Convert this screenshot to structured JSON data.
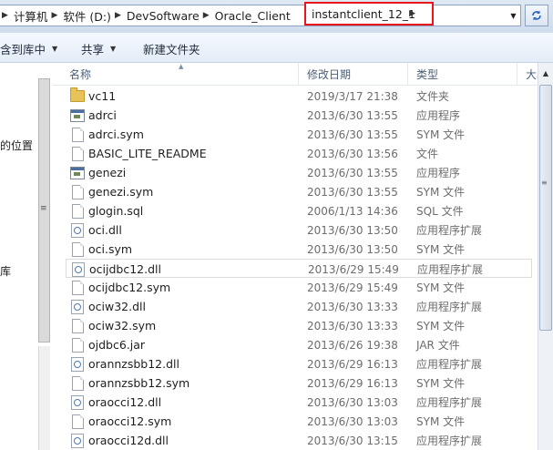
{
  "address": {
    "segments": [
      "计算机",
      "软件 (D:)",
      "DevSoftware",
      "Oracle_Client"
    ],
    "current": "instantclient_12_1"
  },
  "toolbar": {
    "include_in_library": "含到库中",
    "share": "共享",
    "new_folder": "新建文件夹"
  },
  "nav": {
    "items": [
      "的位置",
      "库"
    ]
  },
  "columns": {
    "name": "名称",
    "date": "修改日期",
    "type": "类型",
    "size": "大小"
  },
  "files": [
    {
      "name": "vc11",
      "date": "2019/3/17 21:38",
      "type": "文件夹",
      "icon": "folder-icon"
    },
    {
      "name": "adrci",
      "date": "2013/6/30 13:55",
      "type": "应用程序",
      "icon": "application-icon"
    },
    {
      "name": "adrci.sym",
      "date": "2013/6/30 13:55",
      "type": "SYM 文件",
      "icon": "file-icon"
    },
    {
      "name": "BASIC_LITE_README",
      "date": "2013/6/30 13:56",
      "type": "文件",
      "icon": "file-icon"
    },
    {
      "name": "genezi",
      "date": "2013/6/30 13:55",
      "type": "应用程序",
      "icon": "application-icon"
    },
    {
      "name": "genezi.sym",
      "date": "2013/6/30 13:55",
      "type": "SYM 文件",
      "icon": "file-icon"
    },
    {
      "name": "glogin.sql",
      "date": "2006/1/13 14:36",
      "type": "SQL 文件",
      "icon": "file-icon"
    },
    {
      "name": "oci.dll",
      "date": "2013/6/30 13:50",
      "type": "应用程序扩展",
      "icon": "dll-icon"
    },
    {
      "name": "oci.sym",
      "date": "2013/6/30 13:50",
      "type": "SYM 文件",
      "icon": "file-icon"
    },
    {
      "name": "ocijdbc12.dll",
      "date": "2013/6/29 15:49",
      "type": "应用程序扩展",
      "icon": "dll-icon",
      "selected": true
    },
    {
      "name": "ocijdbc12.sym",
      "date": "2013/6/29 15:49",
      "type": "SYM 文件",
      "icon": "file-icon"
    },
    {
      "name": "ociw32.dll",
      "date": "2013/6/30 13:33",
      "type": "应用程序扩展",
      "icon": "dll-icon"
    },
    {
      "name": "ociw32.sym",
      "date": "2013/6/30 13:33",
      "type": "SYM 文件",
      "icon": "file-icon"
    },
    {
      "name": "ojdbc6.jar",
      "date": "2013/6/26 19:38",
      "type": "JAR 文件",
      "icon": "file-icon"
    },
    {
      "name": "orannzsbb12.dll",
      "date": "2013/6/29 16:13",
      "type": "应用程序扩展",
      "icon": "dll-icon"
    },
    {
      "name": "orannzsbb12.sym",
      "date": "2013/6/29 16:13",
      "type": "SYM 文件",
      "icon": "file-icon"
    },
    {
      "name": "oraocci12.dll",
      "date": "2013/6/30 13:03",
      "type": "应用程序扩展",
      "icon": "dll-icon"
    },
    {
      "name": "oraocci12.sym",
      "date": "2013/6/30 13:03",
      "type": "SYM 文件",
      "icon": "file-icon"
    },
    {
      "name": "oraocci12d.dll",
      "date": "2013/6/30 13:15",
      "type": "应用程序扩展",
      "icon": "dll-icon"
    }
  ],
  "colors": {
    "highlight_border": "#e8151b",
    "folder": "#e8c35a",
    "header_text": "#4c607a"
  }
}
